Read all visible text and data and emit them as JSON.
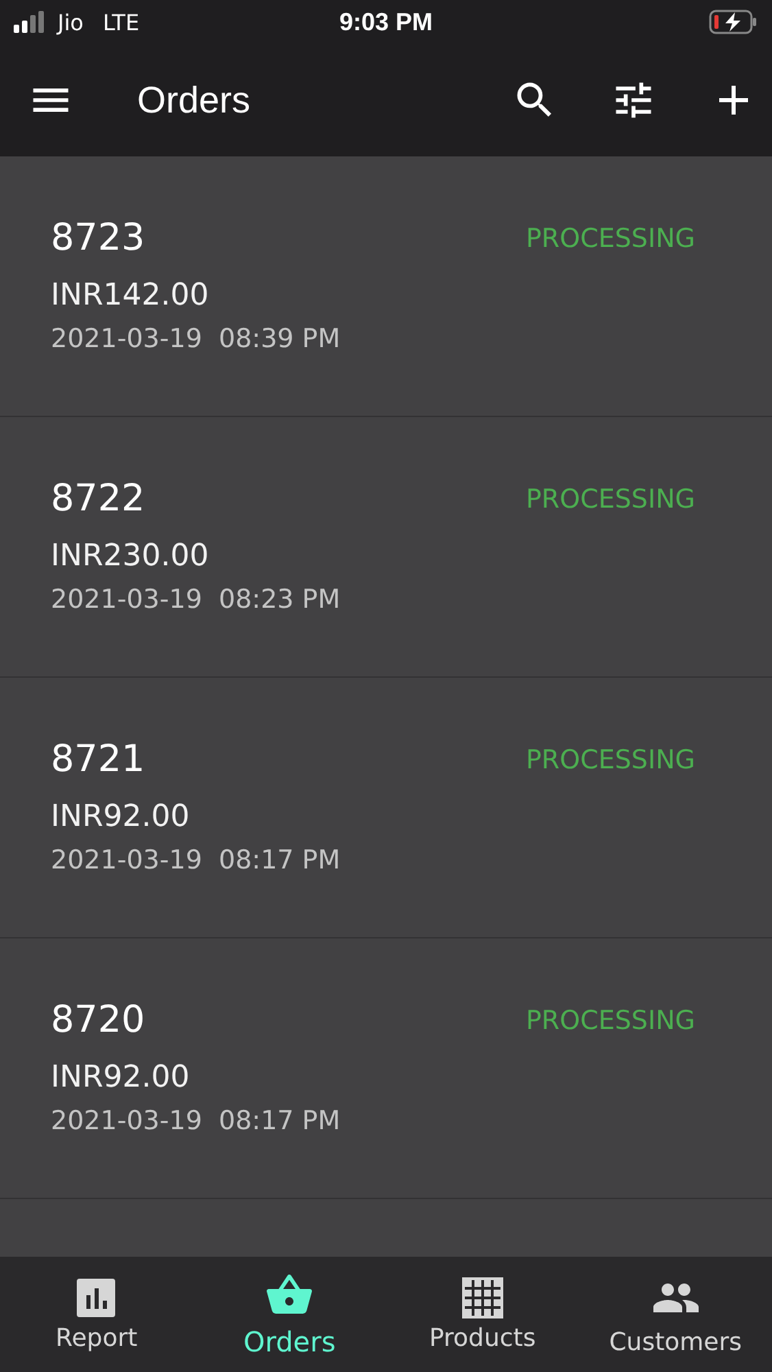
{
  "status_bar": {
    "carrier": "Jio",
    "network": "LTE",
    "time": "9:03 PM"
  },
  "app_bar": {
    "title": "Orders"
  },
  "orders": [
    {
      "number": "8723",
      "status": "PROCESSING",
      "amount": "INR142.00",
      "date": "2021-03-19  08:39 PM"
    },
    {
      "number": "8722",
      "status": "PROCESSING",
      "amount": "INR230.00",
      "date": "2021-03-19  08:23 PM"
    },
    {
      "number": "8721",
      "status": "PROCESSING",
      "amount": "INR92.00",
      "date": "2021-03-19  08:17 PM"
    },
    {
      "number": "8720",
      "status": "PROCESSING",
      "amount": "INR92.00",
      "date": "2021-03-19  08:17 PM"
    }
  ],
  "bottom_nav": [
    {
      "kind": "report",
      "label": "Report",
      "selected": false
    },
    {
      "kind": "orders",
      "label": "Orders",
      "selected": true
    },
    {
      "kind": "products",
      "label": "Products",
      "selected": false
    },
    {
      "kind": "customers",
      "label": "Customers",
      "selected": false
    }
  ]
}
